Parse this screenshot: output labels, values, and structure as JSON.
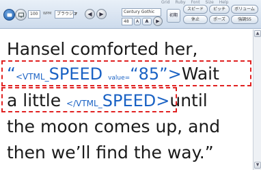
{
  "toolbar": {
    "menu": [
      "Grid",
      "Ruby",
      "Font",
      "Size",
      "Help"
    ],
    "zoom": "100",
    "zoom_unit": "WPM",
    "style_select": "ブラウジュ",
    "font": "Century Gothic",
    "size": "48",
    "grow_label": "A",
    "shrink_label": "A",
    "reset_label": "初期",
    "buttons": [
      "スピード",
      "ピッチ",
      "ボリューム",
      "休止",
      "ポーズ",
      "強調SS"
    ]
  },
  "document": {
    "line1": "Hansel comforted her,",
    "line2": {
      "open_quote": "“",
      "tag_prefix": "<VTML_",
      "tag_word": "SPEED",
      "attr": "value=",
      "value": "“85”",
      "tag_close": ">",
      "text": "Wait"
    },
    "line3": {
      "text_before": "a little ",
      "tag_prefix": "</VTML_",
      "tag_word": "SPEED",
      "tag_close": ">",
      "text_after": "until"
    },
    "line4": "the moon comes up, and",
    "line5": "then we’ll find the way.”"
  },
  "highlight_color": "#e02020",
  "tag_color": "#1a62c4"
}
